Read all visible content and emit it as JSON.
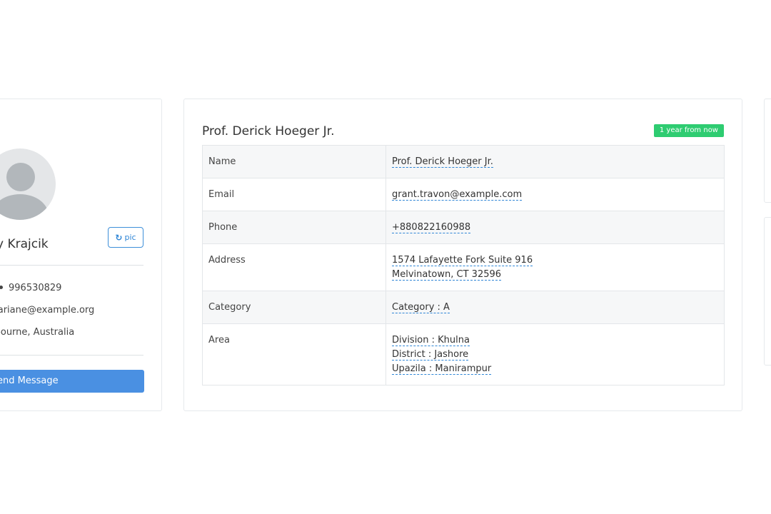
{
  "profile": {
    "name": "ry Krajcik",
    "pic_button_label": "pic",
    "phone": "996530829",
    "email": "l.ariane@example.org",
    "location": "lbourne, Australia",
    "send_message_label": "end Message"
  },
  "details": {
    "title": "Prof. Derick Hoeger Jr.",
    "badge": "1 year from now",
    "rows": [
      {
        "label": "Name",
        "values": [
          "Prof. Derick Hoeger Jr."
        ]
      },
      {
        "label": "Email",
        "values": [
          "grant.travon@example.com"
        ]
      },
      {
        "label": "Phone",
        "values": [
          "+880822160988"
        ]
      },
      {
        "label": "Address",
        "values": [
          "1574 Lafayette Fork Suite 916",
          "Melvinatown, CT 32596"
        ]
      },
      {
        "label": "Category",
        "values": [
          "Category : A"
        ]
      },
      {
        "label": "Area",
        "values": [
          "Division : Khulna",
          "District : Jashore",
          "Upazila : Manirampur"
        ]
      }
    ]
  },
  "colors": {
    "primary": "#4a90e2",
    "badge": "#2ecc71",
    "border": "#e6e9ec"
  },
  "icons": {
    "pic_button": "refresh-icon",
    "avatar": "user-avatar-icon"
  }
}
